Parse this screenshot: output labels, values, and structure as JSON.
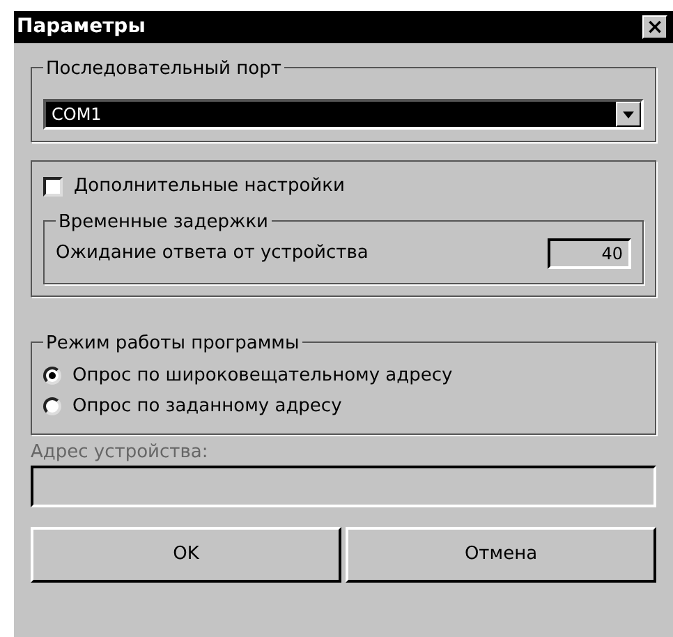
{
  "window": {
    "title": "Параметры",
    "close": "×"
  },
  "serial_port": {
    "title": "Последовательный порт",
    "value": "COM1",
    "selected": true
  },
  "advanced": {
    "label": "Дополнительные настройки",
    "checked": false,
    "delays": {
      "title": "Временные задержки",
      "label": "Ожидание ответа от устройства",
      "value": "40"
    }
  },
  "mode": {
    "title": "Режим работы программы",
    "options": [
      {
        "label": "Опрос по широковещательному адресу",
        "selected": true
      },
      {
        "label": "Опрос по заданному адресу",
        "selected": false
      }
    ]
  },
  "address": {
    "label": "Адрес устройства:",
    "disabled": true
  },
  "buttons": [
    "OK",
    "Отмена"
  ]
}
